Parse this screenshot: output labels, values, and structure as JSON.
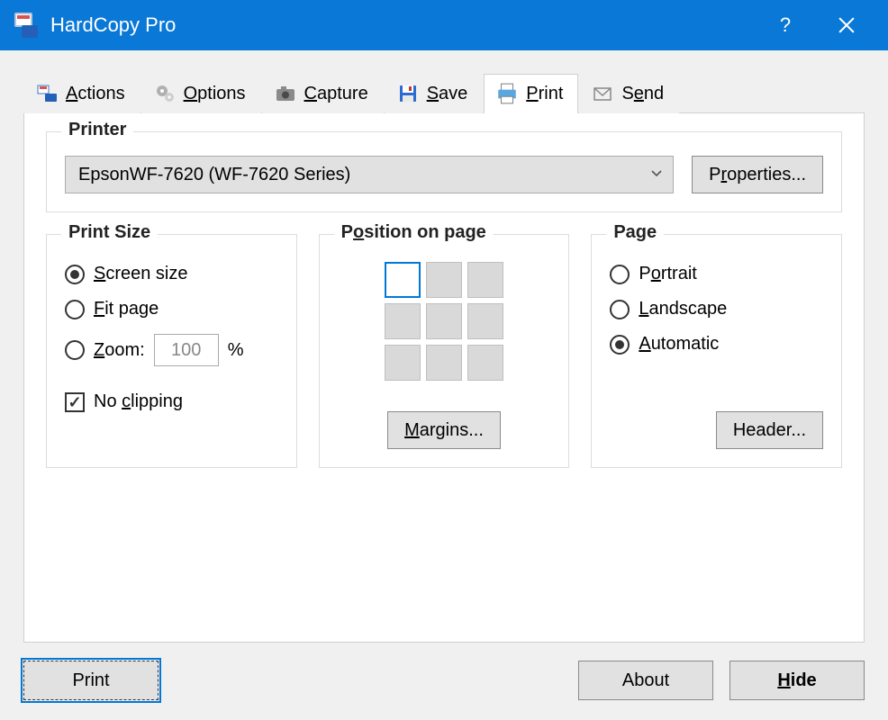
{
  "window": {
    "title": "HardCopy Pro"
  },
  "tabs": {
    "actions": "Actions",
    "options": "Options",
    "capture": "Capture",
    "save": "Save",
    "print": "Print",
    "send": "Send",
    "active": "print"
  },
  "printerGroup": {
    "title": "Printer",
    "selected": "EpsonWF-7620 (WF-7620 Series)",
    "propertiesLabel": "Properties..."
  },
  "printSizeGroup": {
    "title": "Print Size",
    "screen": "Screen size",
    "fit": "Fit page",
    "zoom": "Zoom:",
    "zoomValue": "100",
    "zoomPct": "%",
    "noClipping": "No clipping",
    "selected": "screen",
    "noClippingChecked": true
  },
  "positionGroup": {
    "title": "Position on page",
    "selectedIndex": 0,
    "marginsLabel": "Margins..."
  },
  "pageGroup": {
    "title": "Page",
    "portrait": "Portrait",
    "landscape": "Landscape",
    "automatic": "Automatic",
    "selected": "automatic",
    "headerLabel": "Header..."
  },
  "bottom": {
    "print": "Print",
    "about": "About",
    "hide": "Hide"
  }
}
